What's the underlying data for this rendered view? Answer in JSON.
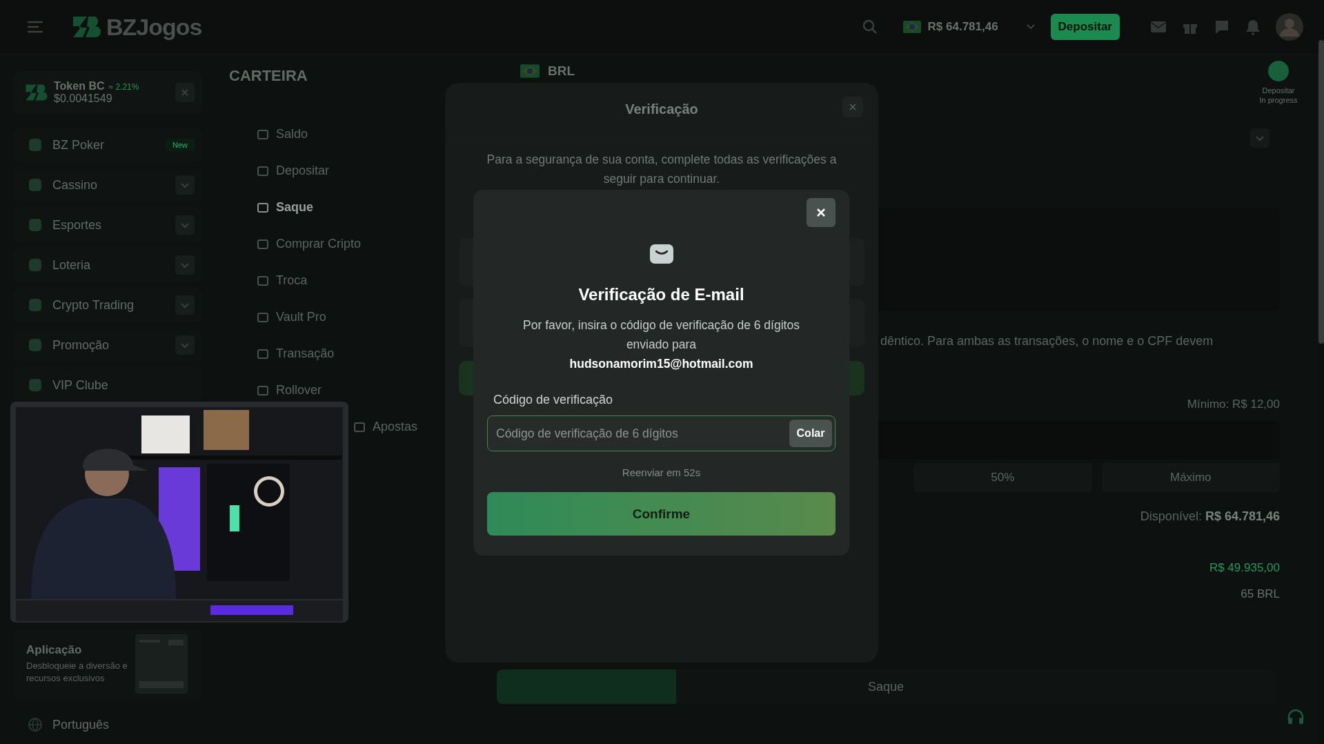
{
  "header": {
    "logo": "BZJogos",
    "balance": "R$ 64.781,46",
    "deposit_button": "Depositar"
  },
  "sidebar": {
    "token": {
      "name": "Token BC",
      "change": "≈ 2.21%",
      "price": "$0.0041549"
    },
    "items": [
      {
        "label": "BZ Poker",
        "badge": "New",
        "expandable": false
      },
      {
        "label": "Cassino",
        "expandable": true
      },
      {
        "label": "Esportes",
        "expandable": true
      },
      {
        "label": "Loteria",
        "expandable": true
      },
      {
        "label": "Crypto Trading",
        "expandable": true
      },
      {
        "label": "Promoção",
        "expandable": true
      },
      {
        "label": "VIP Clube",
        "expandable": false
      }
    ],
    "app_card": {
      "title": "Aplicação",
      "text": "Desbloqueie a diversão e recursos exclusivos"
    },
    "language": "Português"
  },
  "wallet": {
    "title": "CARTEIRA",
    "items": [
      {
        "label": "Saldo",
        "selected": false
      },
      {
        "label": "Depositar",
        "selected": false
      },
      {
        "label": "Saque",
        "selected": true
      },
      {
        "label": "Comprar Cripto",
        "selected": false
      },
      {
        "label": "Troca",
        "selected": false
      },
      {
        "label": "Vault Pro",
        "selected": false
      },
      {
        "label": "Transação",
        "selected": false
      },
      {
        "label": "Rollover",
        "selected": false
      },
      {
        "label": "Apostas",
        "selected": false
      }
    ]
  },
  "withdraw": {
    "currency": "BRL",
    "notice": "dêntico. Para ambas as transações, o nome e o CPF devem",
    "minimum": "Mínimo: R$ 12,00",
    "quick_buttons": [
      "50%",
      "Máximo"
    ],
    "available_label": "Disponível:",
    "available_value": "R$ 64.781,46",
    "amount_converted": "R$ 49.935,00",
    "amount_fee": "65 BRL",
    "bottom_tab": "Saque"
  },
  "deposit_status": {
    "title": "Depositar",
    "state": "In progress"
  },
  "verification_dialog": {
    "title": "Verificação",
    "text": "Para a segurança de sua conta, complete todas as verificações a seguir para continuar."
  },
  "email_dialog": {
    "title": "Verificação de E-mail",
    "text": "Por favor, insira o código de verificação de 6 dígitos enviado para",
    "email": "hudsonamorim15@hotmail.com",
    "field_label": "Código de verificação",
    "placeholder": "Código de verificação de 6 dígitos",
    "paste_button": "Colar",
    "resend": "Reenviar em 52s",
    "confirm_button": "Confirme"
  }
}
